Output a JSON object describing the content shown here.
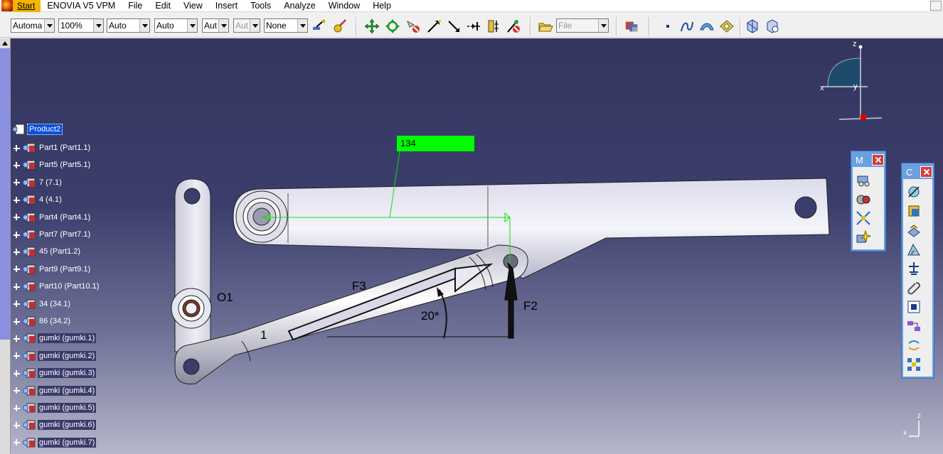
{
  "menu": {
    "start": "Start",
    "items": [
      "ENOVIA V5 VPM",
      "File",
      "Edit",
      "View",
      "Insert",
      "Tools",
      "Analyze",
      "Window",
      "Help"
    ]
  },
  "toolbar": {
    "combos": [
      {
        "value": "Automa"
      },
      {
        "value": "100%"
      },
      {
        "value": "Auto"
      },
      {
        "value": "Auto"
      },
      {
        "value": "Aut"
      },
      {
        "value": "Aut"
      },
      {
        "value": "None"
      },
      {
        "value": "File"
      }
    ]
  },
  "tree": {
    "root": "Product2",
    "items": [
      {
        "label": "Part1 (Part1.1)"
      },
      {
        "label": "Part5 (Part5.1)"
      },
      {
        "label": "7 (7.1)"
      },
      {
        "label": "4 (4.1)"
      },
      {
        "label": "Part4 (Part4.1)"
      },
      {
        "label": "Part7 (Part7.1)"
      },
      {
        "label": "45 (Part1.2)"
      },
      {
        "label": "Part9 (Part9.1)"
      },
      {
        "label": "Part10 (Part10.1)"
      },
      {
        "label": "34 (34.1)"
      },
      {
        "label": "86 (34.2)"
      },
      {
        "label": "gumki (gumki.1)"
      },
      {
        "label": "gumki (gumki.2)"
      },
      {
        "label": "gumki (gumki.3)"
      },
      {
        "label": "gumki (gumki.4)"
      },
      {
        "label": "gumki (gumki.5)"
      },
      {
        "label": "gumki (gumki.6)"
      },
      {
        "label": "gumki (gumki.7)"
      }
    ]
  },
  "model": {
    "dimension": "134",
    "labels": {
      "o1": "O1",
      "f3": "F3",
      "f2": "F2",
      "angle": "20*",
      "part_number": "1"
    }
  },
  "compass": {
    "z": "z",
    "x": "x",
    "y": "y"
  },
  "axis_corner": {
    "z": "z",
    "x": "x"
  },
  "float_toolbars": [
    {
      "title": "M"
    },
    {
      "title": "C"
    }
  ],
  "colors": {
    "menu_start": "#f5b400",
    "dim_box": "#00ff00",
    "selection": "#0a4fd6",
    "float_toolbar": "#6aa0e0"
  }
}
